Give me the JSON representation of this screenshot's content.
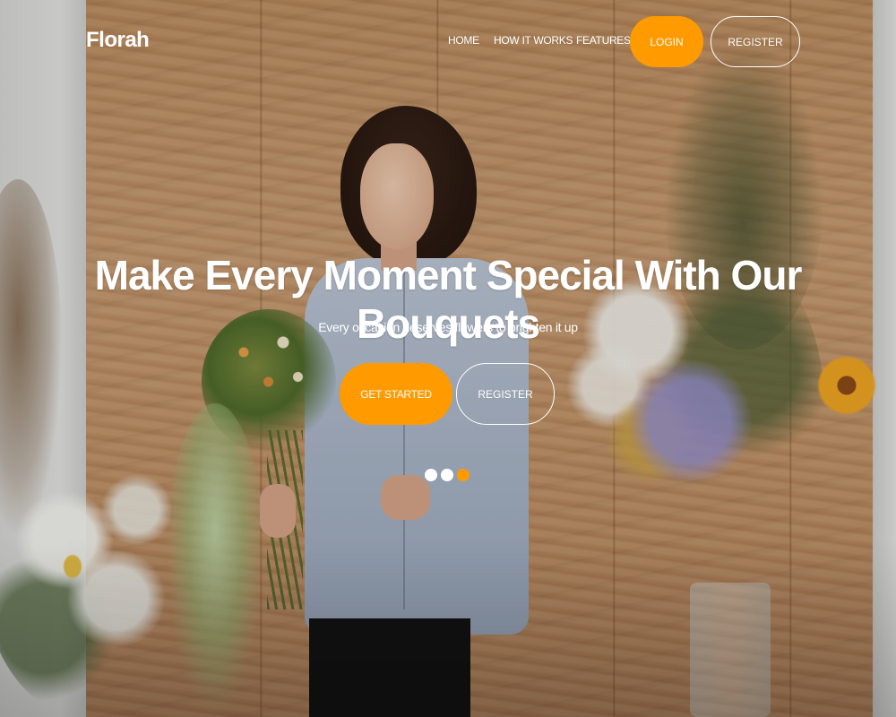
{
  "brand": "Florah",
  "nav": {
    "home": "HOME",
    "how_it_works": "HOW IT WORKS",
    "features": "FEATURES",
    "login": "LOGIN",
    "register": "REGISTER"
  },
  "hero": {
    "title": "Make Every Moment Special With Our Bouquets",
    "subtitle": "Every occasion deserves flowers to brighten it up",
    "primary_cta": "GET STARTED",
    "secondary_cta": "REGISTER"
  },
  "carousel": {
    "slides": 3,
    "active_index": 2
  },
  "colors": {
    "accent": "#ff9a00",
    "text": "#ffffff"
  }
}
